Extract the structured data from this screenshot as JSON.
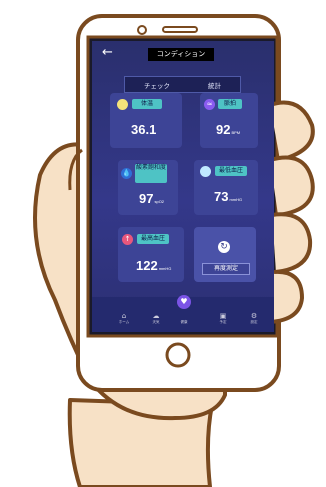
{
  "header": {
    "back_label": "←",
    "title": "コンディション"
  },
  "tabs": [
    "チェック",
    "統計"
  ],
  "metrics": [
    {
      "key": "temperature",
      "label": "体温",
      "value": "36.1",
      "unit": "",
      "icon": "sun-icon",
      "color": "#f4e27a"
    },
    {
      "key": "heart_rate",
      "label": "脈拍",
      "value": "92",
      "unit": "BPM",
      "icon": "heartbeat-icon",
      "color": "#8a5cf0"
    },
    {
      "key": "oxygen",
      "label": "酸素飽和度",
      "value": "97",
      "unit": "spO2",
      "icon": "drop-icon",
      "color": "#2f6fd6"
    },
    {
      "key": "min_bp",
      "label": "最低血圧",
      "value": "73",
      "unit": "mmHG",
      "icon": "circle-icon",
      "color": "#bfe8ff"
    },
    {
      "key": "max_bp",
      "label": "最高血圧",
      "value": "122",
      "unit": "mmHG",
      "icon": "arrow-up-icon",
      "color": "#e8577d"
    }
  ],
  "remeasure_label": "再度測定",
  "remeasure_icon": "refresh-icon",
  "nav": [
    {
      "icon": "home-icon",
      "label": "ホーム"
    },
    {
      "icon": "cloud-icon",
      "label": "天気"
    },
    {
      "icon": "heart-icon",
      "label": "健康"
    },
    {
      "icon": "calendar-icon",
      "label": "予定"
    },
    {
      "icon": "settings-icon",
      "label": "設定"
    }
  ]
}
